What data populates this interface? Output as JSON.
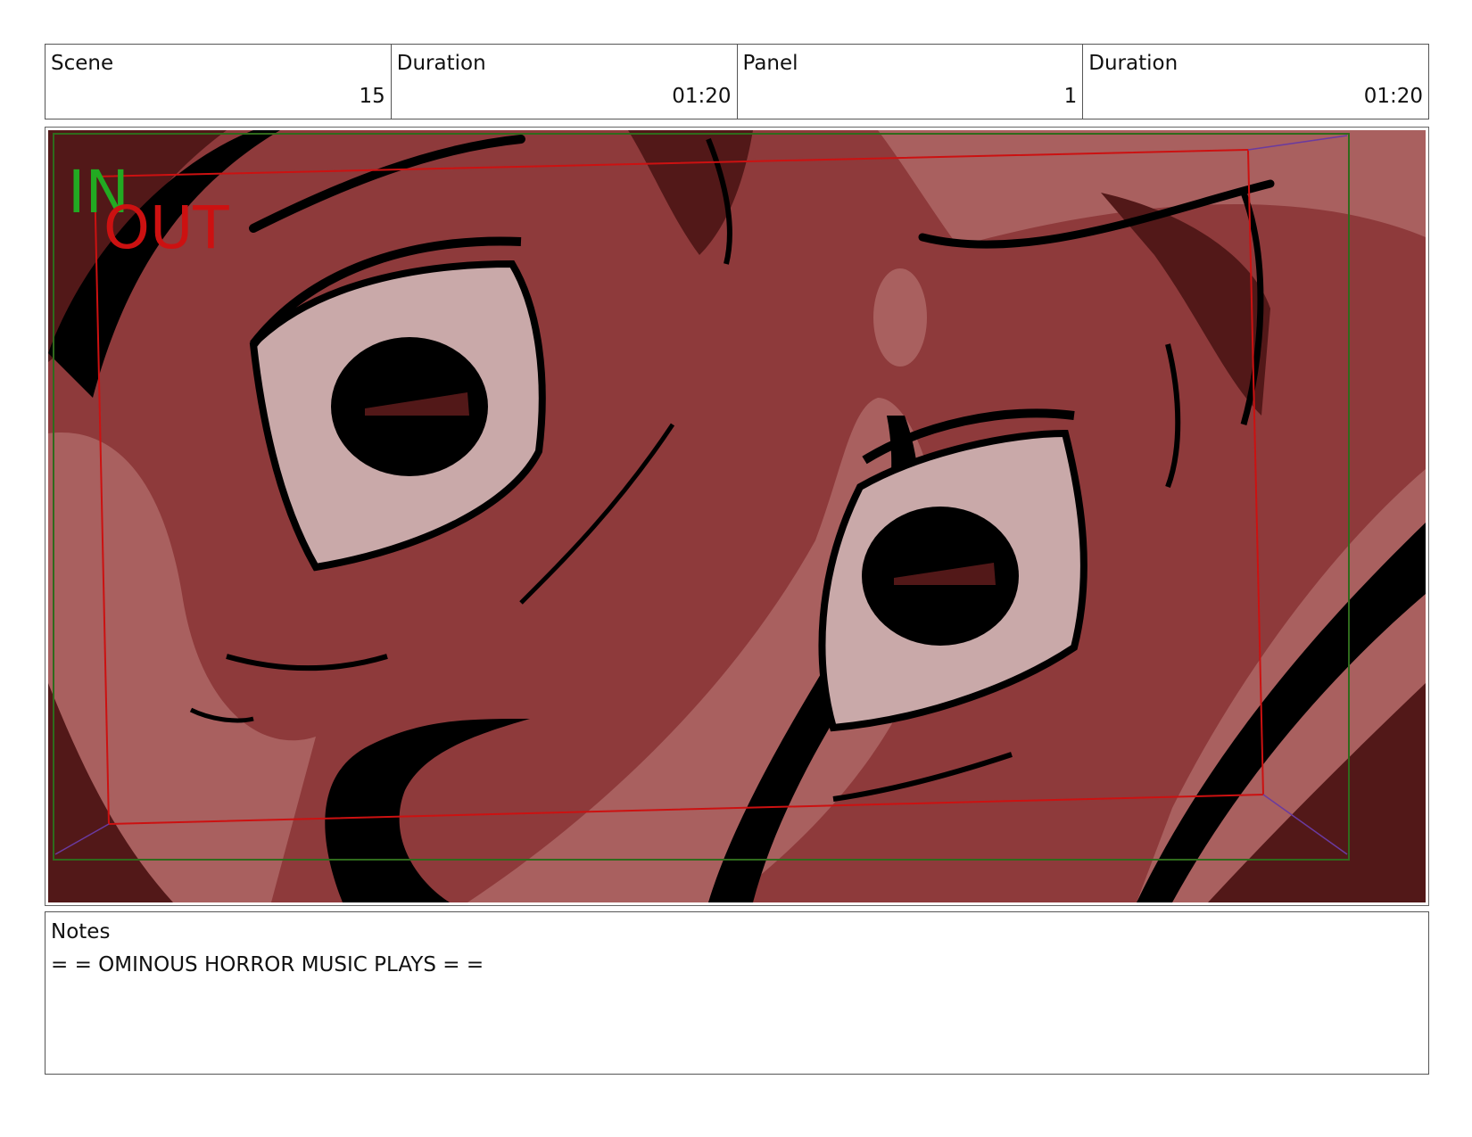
{
  "header": {
    "cells": [
      {
        "label": "Scene",
        "value": "15"
      },
      {
        "label": "Duration",
        "value": "01:20"
      },
      {
        "label": "Panel",
        "value": "1"
      },
      {
        "label": "Duration",
        "value": "01:20"
      }
    ]
  },
  "panel": {
    "in_marker": "IN",
    "out_marker": "OUT",
    "colors": {
      "in": "#22aa22",
      "out": "#cc1111",
      "skin": "#8e3a3b",
      "skin_light": "#a9605f",
      "skin_dark": "#521818",
      "eye_white": "#c9a9a9",
      "ink": "#000000"
    }
  },
  "notes": {
    "label": "Notes",
    "text": "= = OMINOUS HORROR MUSIC PLAYS = ="
  }
}
